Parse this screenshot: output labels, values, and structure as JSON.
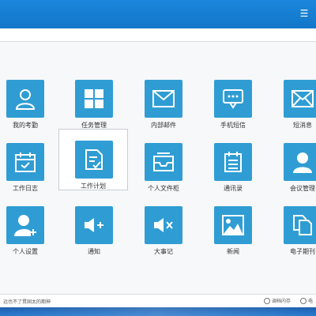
{
  "colors": {
    "accent": "#2f9dd3",
    "topbar": "#1a86dc",
    "taskbar": "#1c5fae"
  },
  "topbar": {
    "menu_icon": "menu-icon"
  },
  "tiles": [
    {
      "label": "我的考勤",
      "icon": "person-icon"
    },
    {
      "label": "任务管理",
      "icon": "grid-icon"
    },
    {
      "label": "内部邮件",
      "icon": "mail-icon"
    },
    {
      "label": "手机短信",
      "icon": "sms-icon"
    },
    {
      "label": "短消息",
      "icon": "envelope-icon"
    },
    {
      "label": "工作日志",
      "icon": "calendar-icon"
    },
    {
      "label": "工作计划",
      "icon": "plan-doc-icon",
      "selected": true
    },
    {
      "label": "个人文件柜",
      "icon": "inbox-tray-icon"
    },
    {
      "label": "通讯录",
      "icon": "address-book-icon"
    },
    {
      "label": "会议管理",
      "icon": "meeting-person-icon"
    },
    {
      "label": "个人设置",
      "icon": "user-settings-icon"
    },
    {
      "label": "通知",
      "icon": "speaker-plus-icon"
    },
    {
      "label": "大事记",
      "icon": "speaker-mute-icon"
    },
    {
      "label": "新闻",
      "icon": "image-icon"
    },
    {
      "label": "电子期刊",
      "icon": "copy-docs-icon"
    }
  ],
  "bottombar": {
    "ticker": "远也不了贯固太的期神",
    "status_left": "调档内存",
    "status_right": "电"
  }
}
